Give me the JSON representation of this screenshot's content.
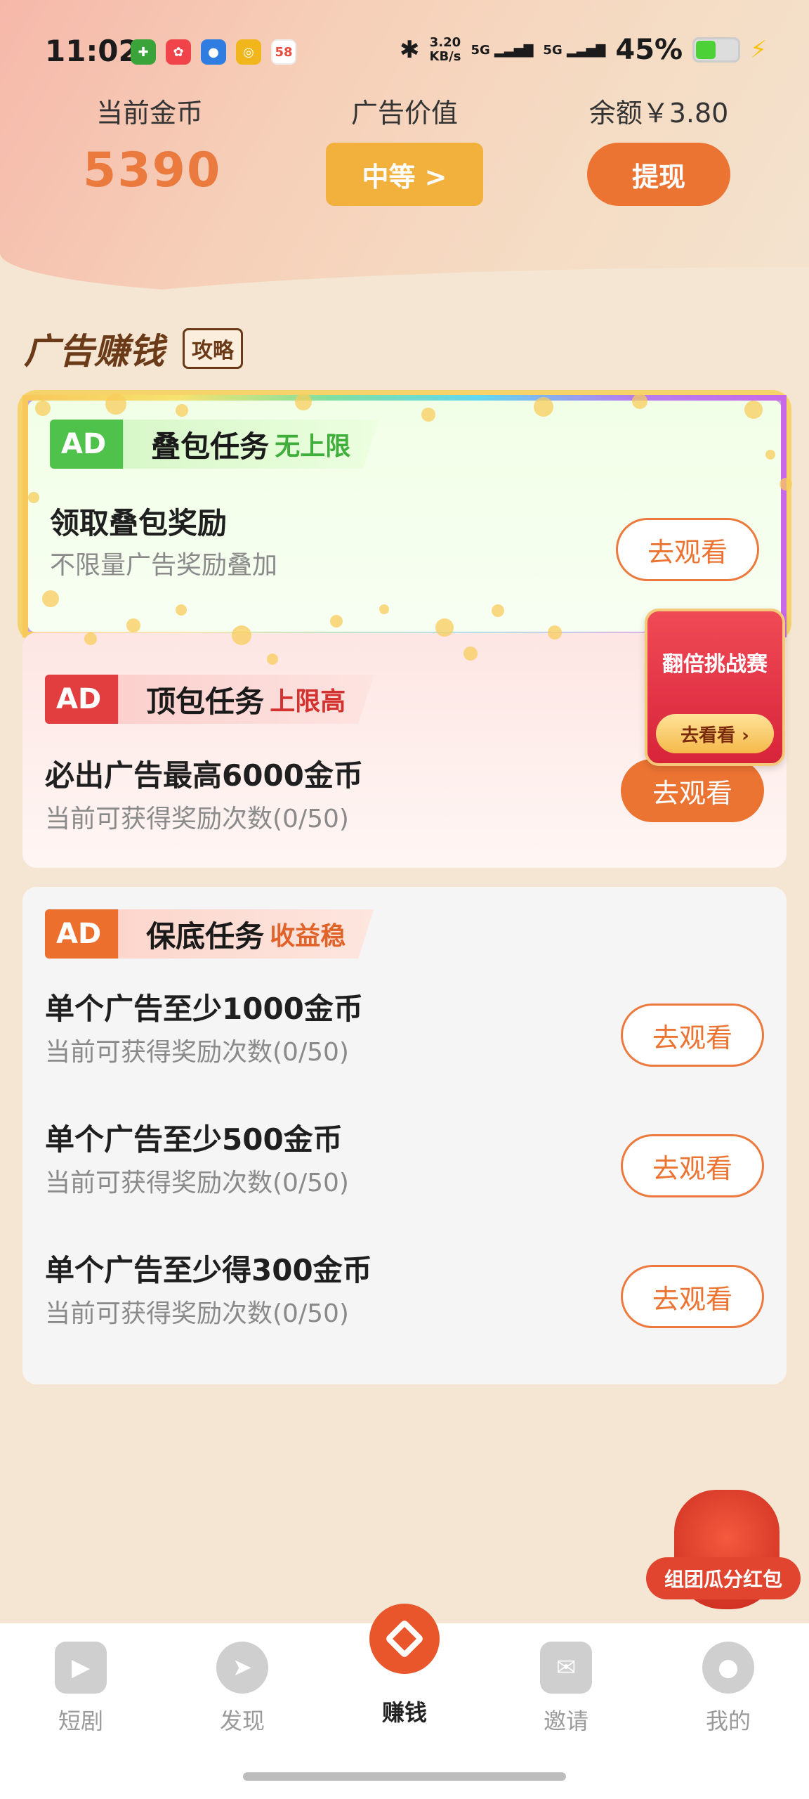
{
  "status_bar": {
    "time": "11:02",
    "net_speed": "3.20",
    "net_unit": "KB/s",
    "signal1": "5G",
    "signal2": "5G",
    "battery": "45%",
    "battery_level": 0.45
  },
  "header": {
    "coins_label": "当前金币",
    "coins_value": "5390",
    "ad_value_label": "广告价值",
    "ad_value_button": "中等 >",
    "balance_label": "余额￥3.80",
    "withdraw_button": "提现"
  },
  "section": {
    "title": "广告赚钱",
    "guide_tag": "攻略"
  },
  "tasks": [
    {
      "badge": "AD",
      "name": "叠包任务",
      "tag": "无上限",
      "title": "领取叠包奖励",
      "subtitle": "不限量广告奖励叠加",
      "button": "去观看"
    },
    {
      "badge": "AD",
      "name": "顶包任务",
      "tag": "上限高",
      "title": "必出广告最高6000金币",
      "subtitle": "当前可获得奖励次数(0/50)",
      "button": "去观看"
    },
    {
      "badge": "AD",
      "name": "保底任务",
      "tag": "收益稳",
      "rows": [
        {
          "title": "单个广告至少1000金币",
          "subtitle": "当前可获得奖励次数(0/50)",
          "button": "去观看"
        },
        {
          "title": "单个广告至少500金币",
          "subtitle": "当前可获得奖励次数(0/50)",
          "button": "去观看"
        },
        {
          "title": "单个广告至少得300金币",
          "subtitle": "当前可获得奖励次数(0/50)",
          "button": "去观看"
        }
      ]
    }
  ],
  "float_challenge": {
    "title": "翻倍挑战赛",
    "button": "去看看 ›"
  },
  "float_bag": {
    "label": "组团瓜分红包"
  },
  "tabs": [
    {
      "label": "短剧",
      "icon": "play-icon"
    },
    {
      "label": "发现",
      "icon": "compass-icon"
    },
    {
      "label": "赚钱",
      "icon": "diamond-icon",
      "active": true
    },
    {
      "label": "邀请",
      "icon": "mail-icon"
    },
    {
      "label": "我的",
      "icon": "profile-icon"
    }
  ],
  "colors": {
    "accent": "#ec7433",
    "gold": "#f2b13d",
    "green_badge": "#4fc24b",
    "red_badge": "#e23d3f",
    "orange_badge": "#ec6f2e"
  }
}
